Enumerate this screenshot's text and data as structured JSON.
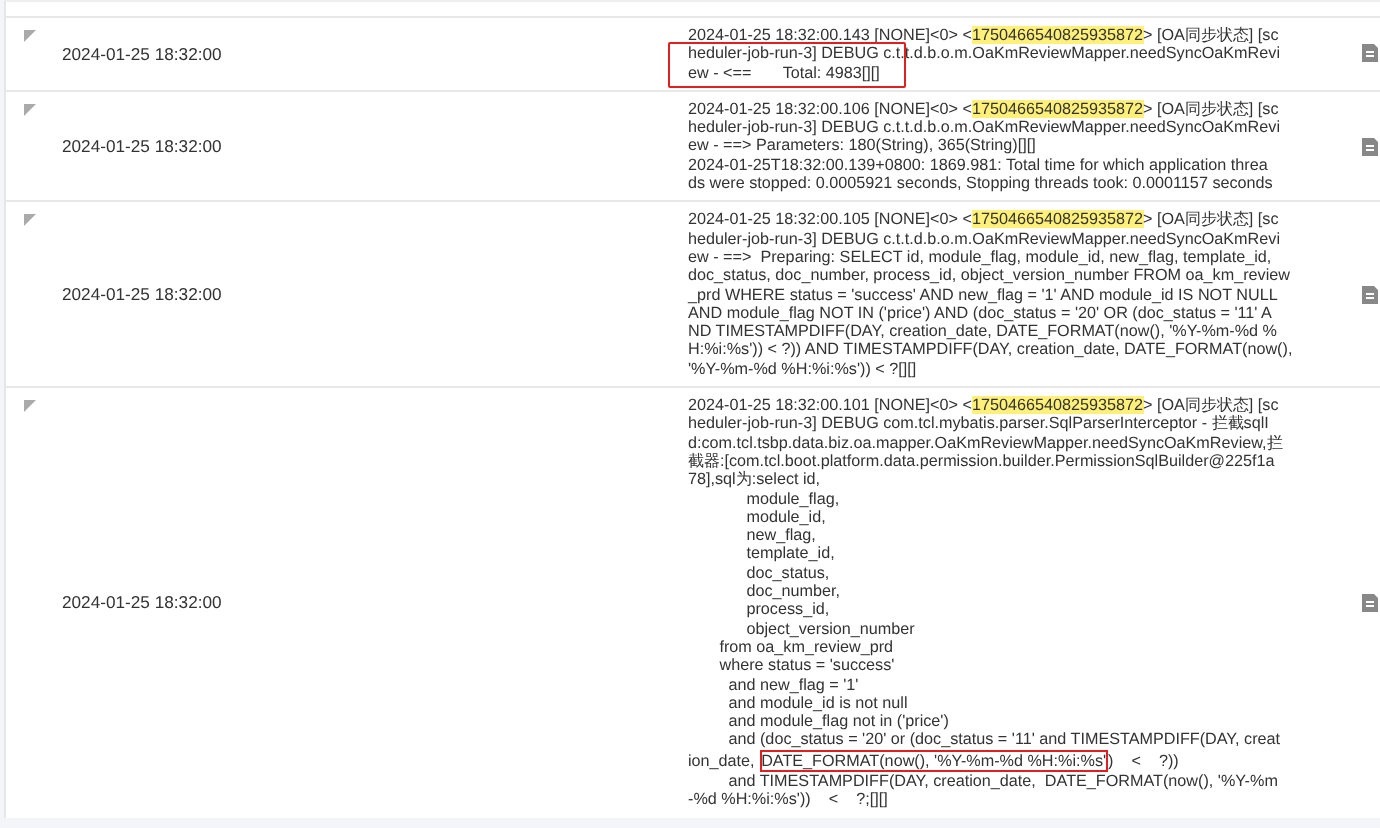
{
  "rows": [
    {
      "time": "2024-01-25 18:32:00",
      "marked": true,
      "message": {
        "prefix": "2024-01-25 18:32:00.143 [NONE]<0> <",
        "trace_id": "1750466540825935872",
        "suffix": "> [OA同步状态] [sc",
        "lines": [
          [
            "heduler-job-run-3] DEBUG c.t.t.d.b.o.m.OaKmReviewMapper.needSyncOaKmRevi"
          ],
          [
            "ew - <==       Total: 4983[][]"
          ]
        ]
      }
    },
    {
      "time": "2024-01-25 18:32:00",
      "marked": false,
      "message": {
        "prefix": "2024-01-25 18:32:00.106 [NONE]<0> <",
        "trace_id": "1750466540825935872",
        "suffix": "> [OA同步状态] [sc",
        "lines": [
          [
            "heduler-job-run-3] DEBUG c.t.t.d.b.o.m.OaKmReviewMapper.needSyncOaKmRevi"
          ],
          [
            "ew - ==> Parameters: 180(String), 365(String)[][]"
          ],
          [
            "2024-01-25T18:32:00.139+0800: 1869.981: Total time for which application threa"
          ],
          [
            "ds were stopped: 0.0005921 seconds, Stopping threads took: 0.0001157 seconds"
          ]
        ]
      }
    },
    {
      "time": "2024-01-25 18:32:00",
      "marked": false,
      "message": {
        "prefix": "2024-01-25 18:32:00.105 [NONE]<0> <",
        "trace_id": "1750466540825935872",
        "suffix": "> [OA同步状态] [sc",
        "lines": [
          [
            "heduler-job-run-3] DEBUG c.t.t.d.b.o.m.OaKmReviewMapper.needSyncOaKmRevi"
          ],
          [
            "ew - ==>  Preparing: SELECT id, module_flag, module_id, new_flag, template_id,"
          ],
          [
            "doc_status, doc_number, process_id, object_version_number FROM oa_km_review"
          ],
          [
            "_prd WHERE status = 'success' AND new_flag = '1' AND module_id IS NOT NULL"
          ],
          [
            "AND module_flag NOT IN ('price') AND (doc_status = '20' OR (doc_status = '11' A"
          ],
          [
            "ND TIMESTAMPDIFF(DAY, creation_date, DATE_FORMAT(now(), '%Y-%m-%d %"
          ],
          [
            "H:%i:%s')) < ?)) AND TIMESTAMPDIFF(DAY, creation_date, DATE_FORMAT(now(),"
          ],
          [
            "'%Y-%m-%d %H:%i:%s')) < ?[][]"
          ]
        ]
      }
    },
    {
      "time": "2024-01-25 18:32:00",
      "marked": false,
      "message": {
        "prefix": "2024-01-25 18:32:00.101 [NONE]<0> <",
        "trace_id": "1750466540825935872",
        "suffix": "> [OA同步状态] [sc",
        "lines": [
          [
            "heduler-job-run-3] DEBUG com.tcl.mybatis.parser.SqlParserInterceptor - 拦截sqlI"
          ],
          [
            "d:com.tcl.tsbp.data.biz.oa.mapper.OaKmReviewMapper.needSyncOaKmReview,拦"
          ],
          [
            "截器:[com.tcl.boot.platform.data.permission.builder.PermissionSqlBuilder@225f1a"
          ],
          [
            "78],sql为:select id,"
          ],
          [
            "             module_flag,"
          ],
          [
            "             module_id,"
          ],
          [
            "             new_flag,"
          ],
          [
            "             template_id,"
          ],
          [
            "             doc_status,"
          ],
          [
            "             doc_number,"
          ],
          [
            "             process_id,"
          ],
          [
            "             object_version_number"
          ],
          [
            "       from oa_km_review_prd"
          ],
          [
            "       where status = 'success'"
          ],
          [
            "         and new_flag = '1'"
          ],
          [
            "         and module_id is not null"
          ],
          [
            "         and module_flag not in ('price')"
          ],
          [
            "         and (doc_status = '20' or (doc_status = '11' and TIMESTAMPDIFF(DAY, creat"
          ],
          [
            "ion_date, ",
            {
              "text": "DATE_FORMAT(now(), '%Y-%m-%d %H:%i:%s'",
              "boxed": true
            },
            ")    <    ?))"
          ],
          [
            "         and TIMESTAMPDIFF(DAY, creation_date,  DATE_FORMAT(now(), '%Y-%m"
          ],
          [
            "-%d %H:%i:%s'))    <    ?;[][]"
          ]
        ]
      }
    }
  ]
}
